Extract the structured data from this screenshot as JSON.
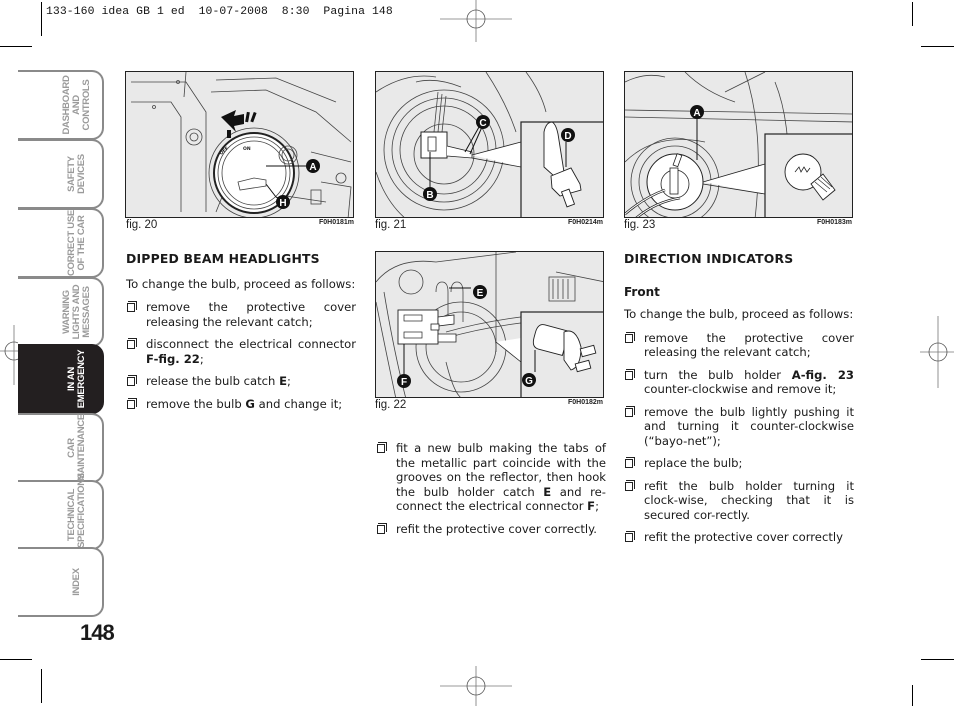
{
  "print_header": "133-160 idea GB 1 ed  10-07-2008  8:30  Pagina 148",
  "page_number": "148",
  "side_tabs": [
    {
      "label": "DASHBOARD\nAND CONTROLS",
      "active": false
    },
    {
      "label": "SAFETY\nDEVICES",
      "active": false
    },
    {
      "label": "CORRECT USE\nOF THE CAR",
      "active": false
    },
    {
      "label": "WARNING\nLIGHTS AND\nMESSAGES",
      "active": false
    },
    {
      "label": "IN AN\nEMERGENCY",
      "active": true
    },
    {
      "label": "CAR\nMAINTENANCE",
      "active": false
    },
    {
      "label": "TECHNICAL\nSPECIFICATIONS",
      "active": false
    },
    {
      "label": "INDEX",
      "active": false
    }
  ],
  "figures": {
    "fig20": {
      "caption": "fig. 20",
      "code": "F0H0181m",
      "callouts": [
        "A",
        "H"
      ],
      "dial_labels": [
        "OFF",
        "ON"
      ]
    },
    "fig21": {
      "caption": "fig. 21",
      "code": "F0H0214m",
      "callouts": [
        "B",
        "C",
        "D"
      ]
    },
    "fig22": {
      "caption": "fig. 22",
      "code": "F0H0182m",
      "callouts": [
        "E",
        "F",
        "G"
      ]
    },
    "fig23": {
      "caption": "fig. 23",
      "code": "F0H0183m",
      "callouts": [
        "A"
      ]
    }
  },
  "dipped_beam": {
    "heading": "DIPPED BEAM HEADLIGHTS",
    "intro": "To change the bulb, proceed as follows:",
    "steps": [
      {
        "text": "remove the protective cover releasing the relevant catch;"
      },
      {
        "pre": "disconnect the electrical connector ",
        "bold": "F-fig. 22",
        "post": ";"
      },
      {
        "pre": "release the bulb catch ",
        "bold": "E",
        "post": ";"
      },
      {
        "pre": "remove the bulb ",
        "bold": "G",
        "post": " and change it;"
      }
    ],
    "steps_cont": [
      {
        "pre": "fit a new bulb making the tabs of the metallic part coincide with the grooves on the reflector, then hook the bulb holder catch ",
        "bold": "E",
        "mid": " and re-connect the electrical connector ",
        "bold2": "F",
        "post": ";"
      },
      {
        "text": "refit the protective cover correctly."
      }
    ]
  },
  "direction_indicators": {
    "heading": "DIRECTION INDICATORS",
    "subheading": "Front",
    "intro": "To change the bulb, proceed as follows:",
    "steps": [
      {
        "text": "remove the protective cover releasing the relevant catch;"
      },
      {
        "pre": "turn the bulb holder ",
        "bold": "A-fig. 23",
        "post": " counter-clockwise and remove it;"
      },
      {
        "text": "remove the bulb lightly pushing it and turning it counter-clockwise (“bayo-net”);"
      },
      {
        "text": "replace the bulb;"
      },
      {
        "text": "refit the bulb holder turning it clock-wise, checking that it is secured cor-rectly."
      },
      {
        "text": "refit the protective cover correctly"
      }
    ]
  }
}
